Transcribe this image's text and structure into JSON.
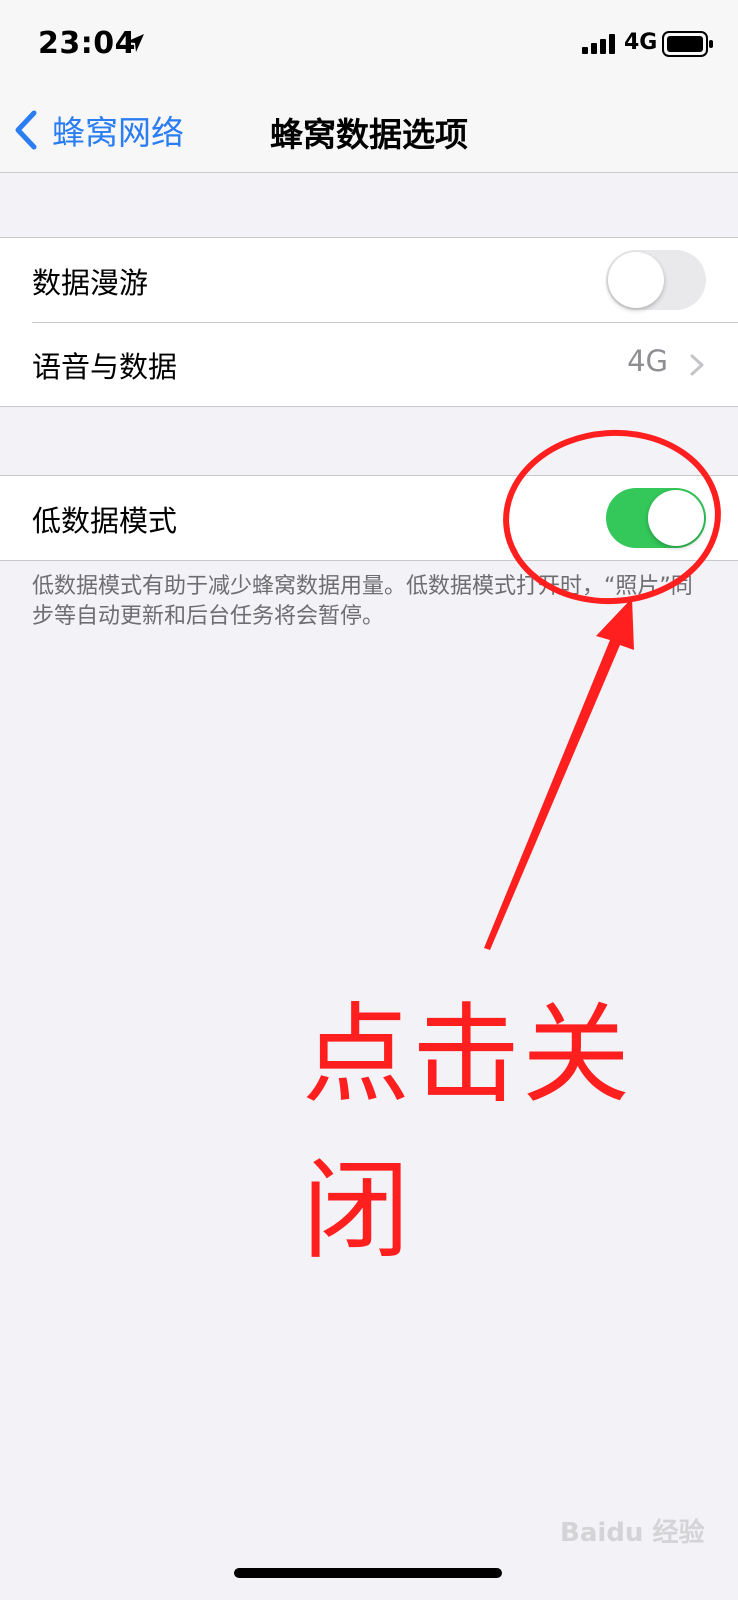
{
  "status_bar": {
    "time": "23:04",
    "location_icon": "location-arrow-icon",
    "network": "4G",
    "signal_icon": "cellular-signal-icon",
    "battery_icon": "battery-icon"
  },
  "nav": {
    "back_label": "蜂窝网络",
    "back_icon": "chevron-left-icon",
    "title": "蜂窝数据选项"
  },
  "groups": [
    {
      "cells": [
        {
          "label": "数据漫游",
          "toggle_state": "off"
        },
        {
          "label": "语音与数据",
          "detail": "4G",
          "chevron_icon": "chevron-right-icon"
        }
      ]
    },
    {
      "cells": [
        {
          "label": "低数据模式",
          "toggle_state": "on"
        }
      ],
      "footer": "低数据模式有助于减少蜂窝数据用量。低数据模式打开时，“照片”同步等自动更新和后台任务将会暂停。"
    }
  ],
  "annotation": {
    "text": "点击关闭",
    "color": "#ff1f1f"
  },
  "watermark": "Baidu 经验",
  "colors": {
    "accent_blue": "#2a7df2",
    "toggle_on": "#34c759",
    "toggle_off": "#e9e9eb",
    "background": "#f2f2f7"
  }
}
